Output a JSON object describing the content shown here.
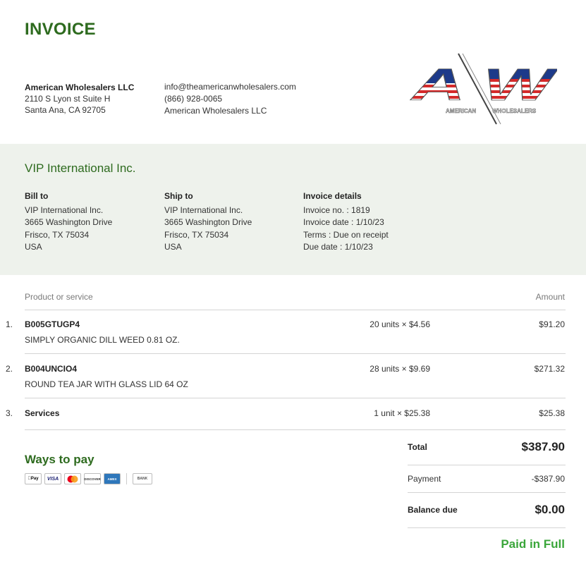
{
  "document": {
    "title": "INVOICE"
  },
  "seller": {
    "name": "American Wholesalers LLC",
    "address_line1": "2110 S Lyon st Suite H",
    "address_line2": "Santa Ana, CA 92705",
    "email": "info@theamericanwholesalers.com",
    "phone": "(866) 928-0065",
    "company": "American Wholesalers LLC"
  },
  "logo": {
    "letters": "AW",
    "tagline_left": "AMERICAN",
    "tagline_right": "WHOLESALERS",
    "colors": {
      "red": "#d42a2a",
      "blue": "#1d3a8a",
      "white": "#ffffff"
    }
  },
  "client": {
    "name": "VIP International Inc.",
    "bill_to": {
      "label": "Bill to",
      "name": "VIP International Inc.",
      "street": "3665 Washington Drive",
      "city": "Frisco, TX 75034",
      "country": "USA"
    },
    "ship_to": {
      "label": "Ship to",
      "name": "VIP International Inc.",
      "street": "3665 Washington Drive",
      "city": "Frisco, TX 75034",
      "country": "USA"
    },
    "invoice_details": {
      "label": "Invoice details",
      "number": "Invoice no. : 1819",
      "date": "Invoice date : 1/10/23",
      "terms": "Terms : Due on receipt",
      "due": "Due date : 1/10/23"
    }
  },
  "table": {
    "headers": {
      "product": "Product or service",
      "amount": "Amount"
    },
    "rows": [
      {
        "num": "1.",
        "sku": "B005GTUGP4",
        "desc": "SIMPLY ORGANIC DILL WEED 0.81 OZ.",
        "qty": "20 units × $4.56",
        "amount": "$91.20"
      },
      {
        "num": "2.",
        "sku": "B004UNCIO4",
        "desc": "ROUND TEA JAR WITH GLASS LID 64 OZ",
        "qty": "28 units × $9.69",
        "amount": "$271.32"
      },
      {
        "num": "3.",
        "sku": "Services",
        "desc": "",
        "qty": "1 unit × $25.38",
        "amount": "$25.38"
      }
    ]
  },
  "payment_methods": {
    "title": "Ways to pay",
    "icons": [
      {
        "name": "apple-pay-icon",
        "label": "Pay"
      },
      {
        "name": "visa-icon",
        "label": "VISA"
      },
      {
        "name": "mastercard-icon",
        "label": ""
      },
      {
        "name": "discover-icon",
        "label": "DISCOVER"
      },
      {
        "name": "amex-icon",
        "label": "AMEX"
      },
      {
        "name": "bank-icon",
        "label": "BANK"
      }
    ]
  },
  "summary": {
    "total_label": "Total",
    "total": "$387.90",
    "payment_label": "Payment",
    "payment": "-$387.90",
    "balance_label": "Balance due",
    "balance": "$0.00",
    "status": "Paid in Full"
  },
  "colors": {
    "brand_green": "#2e6b1f",
    "paid_green": "#3aa63a",
    "band_bg": "#eef2ec"
  }
}
